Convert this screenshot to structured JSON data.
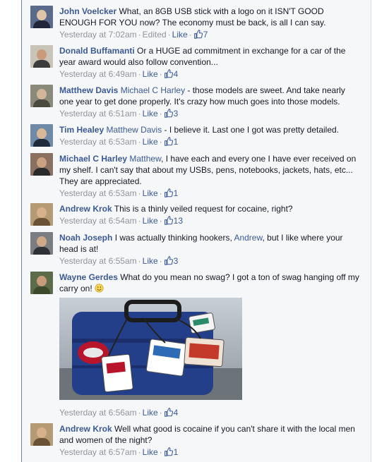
{
  "comments": [
    {
      "author": "John Voelcker",
      "segments": [
        {
          "type": "text",
          "value": " What, an 8GB USB stick with a logo on it ISN'T GOOD ENOUGH FOR YOU now? The economy must be back, is all I can say."
        }
      ],
      "timestamp": "Yesterday at 7:02am",
      "edited": "Edited",
      "like_label": "Like",
      "likes": "7",
      "avatar_colors": {
        "bg": "#5a6a8a",
        "head": "#e0c4a8",
        "body": "#22283a"
      }
    },
    {
      "author": "Donald Buffamanti",
      "segments": [
        {
          "type": "text",
          "value": " Or a HUGE ad commitment in exchange for a car of the year award would also follow convention..."
        }
      ],
      "timestamp": "Yesterday at 6:49am",
      "like_label": "Like",
      "likes": "4",
      "avatar_colors": {
        "bg": "#c9c4b8",
        "head": "#c89b7b",
        "body": "#3c3c3c"
      }
    },
    {
      "author": "Matthew Davis",
      "segments": [
        {
          "type": "text",
          "value": " "
        },
        {
          "type": "mention",
          "value": "Michael C Harley"
        },
        {
          "type": "text",
          "value": " - those models are sweet. And take nearly one year to get done properly. It's crazy how much goes into those models."
        }
      ],
      "timestamp": "Yesterday at 6:51am",
      "like_label": "Like",
      "likes": "3",
      "avatar_colors": {
        "bg": "#8a8a7a",
        "head": "#d3b59a",
        "body": "#4a4a40"
      }
    },
    {
      "author": "Tim Healey",
      "segments": [
        {
          "type": "text",
          "value": " "
        },
        {
          "type": "mention",
          "value": "Matthew Davis"
        },
        {
          "type": "text",
          "value": " - I believe it. Last one I got was pretty detailed."
        }
      ],
      "timestamp": "Yesterday at 6:53am",
      "like_label": "Like",
      "likes": "1",
      "avatar_colors": {
        "bg": "#6f8aa6",
        "head": "#d8b896",
        "body": "#1e2a3a"
      }
    },
    {
      "author": "Michael C Harley",
      "segments": [
        {
          "type": "text",
          "value": " "
        },
        {
          "type": "mention",
          "value": "Matthew"
        },
        {
          "type": "text",
          "value": ", I have each and every one I have ever received on my shelf. I can't say that about my USBs, pens, notebooks, jackets, hats, etc... They are appreciated."
        }
      ],
      "timestamp": "Yesterday at 6:53am",
      "like_label": "Like",
      "likes": "1",
      "avatar_colors": {
        "bg": "#8a7060",
        "head": "#caa282",
        "body": "#2a2a2a"
      }
    },
    {
      "author": "Andrew Krok",
      "segments": [
        {
          "type": "text",
          "value": " This is a thinly veiled request for cocaine, right?"
        }
      ],
      "timestamp": "Yesterday at 6:54am",
      "like_label": "Like",
      "likes": "13",
      "avatar_colors": {
        "bg": "#b59a76",
        "head": "#d8b08a",
        "body": "#6a5236"
      }
    },
    {
      "author": "Noah Joseph",
      "segments": [
        {
          "type": "text",
          "value": " I was actually thinking hookers, "
        },
        {
          "type": "mention",
          "value": "Andrew"
        },
        {
          "type": "text",
          "value": ", but I like where your head is at!"
        }
      ],
      "timestamp": "Yesterday at 6:55am",
      "like_label": "Like",
      "likes": "3",
      "avatar_colors": {
        "bg": "#7a7e82",
        "head": "#cfa88a",
        "body": "#2e3236"
      }
    },
    {
      "author": "Wayne Gerdes",
      "segments": [
        {
          "type": "text",
          "value": " What do you mean no swag? I got a ton of swag hanging off my carry on! "
        },
        {
          "type": "emoji",
          "value": "smile"
        }
      ],
      "timestamp": "Yesterday at 6:56am",
      "like_label": "Like",
      "likes": "4",
      "has_photo": true,
      "avatar_colors": {
        "bg": "#5c6b4a",
        "head": "#c89c7a",
        "body": "#3a4a2a"
      }
    },
    {
      "author": "Andrew Krok",
      "segments": [
        {
          "type": "text",
          "value": " Well what good is cocaine if you can't share it with the local men and women of the night?"
        }
      ],
      "timestamp": "Yesterday at 6:57am",
      "like_label": "Like",
      "likes": "1",
      "avatar_colors": {
        "bg": "#b59a76",
        "head": "#d8b08a",
        "body": "#6a5236"
      }
    }
  ],
  "colors": {
    "link": "#3b5998",
    "meta": "#90949c",
    "text": "#141823",
    "panel": "#f6f7f9"
  },
  "icons": {
    "like": "thumbs-up-icon",
    "emoji": "smile-emoji-icon"
  }
}
